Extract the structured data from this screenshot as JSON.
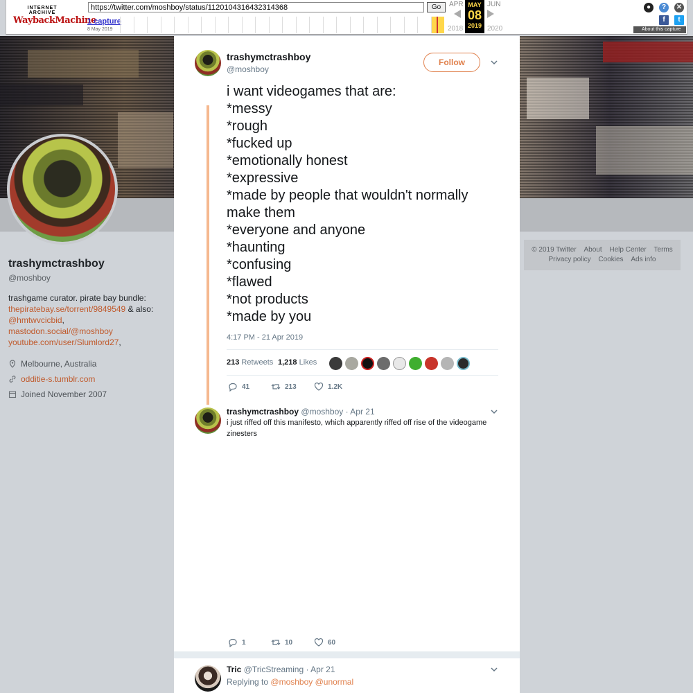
{
  "wayback": {
    "logo_top": "INTERNET ARCHIVE",
    "logo_main": "WaybackMachine",
    "url": "https://twitter.com/moshboy/status/1120104316432314368",
    "go_label": "Go",
    "captures_label": "1 capture",
    "capture_date": "8 May 2019",
    "prev_month": "APR",
    "cur_month": "MAY",
    "next_month": "JUN",
    "cur_day": "08",
    "prev_year": "2018",
    "cur_year": "2019",
    "next_year": "2020",
    "about_label": "About this capture",
    "accent": "#ffd74a"
  },
  "profile": {
    "name": "trashymctrashboy",
    "handle": "@moshboy",
    "bio_line1": "trashgame curator. pirate bay bundle:",
    "bio_link1": "thepiratebay.se/torrent/9849549",
    "bio_mid": " & also:",
    "bio_link2": "@hmtwvcicbid",
    "bio_sep": ", ",
    "bio_link3": "mastodon.social/@moshboy",
    "bio_link4": "youtube.com/user/Slumlord27",
    "bio_end": ",",
    "location": "Melbourne, Australia",
    "website": "odditie-s.tumblr.com",
    "joined": "Joined November 2007",
    "link_color": "#c05a2c"
  },
  "footer": {
    "links_row1": [
      "© 2019 Twitter",
      "About",
      "Help Center",
      "Terms"
    ],
    "links_row2": [
      "Privacy policy",
      "Cookies",
      "Ads info"
    ]
  },
  "tweet": {
    "name": "trashymctrashboy",
    "handle": "@moshboy",
    "follow_label": "Follow",
    "lines": [
      "i want videogames that are:",
      "*messy",
      "*rough",
      "*fucked up",
      "*emotionally honest",
      "*expressive",
      "*made by people that wouldn't normally",
      "make them",
      "*everyone and anyone",
      "*haunting",
      "*confusing",
      "*flawed",
      "*not products",
      "*made by you"
    ],
    "timestamp": "4:17 PM - 21 Apr 2019",
    "retweets_count": "213",
    "retweets_label": "Retweets",
    "likes_count": "1,218",
    "likes_label": "Likes",
    "reply_count": "41",
    "retweet_count": "213",
    "like_count": "1.2K",
    "accent": "#e0814d"
  },
  "reply1": {
    "name": "trashymctrashboy",
    "handle": "@moshboy",
    "date": "· Apr 21",
    "text": "i just riffed off this manifesto, which apparently riffed off rise of the videogame zinesters",
    "reply_count": "1",
    "retweet_count": "10",
    "like_count": "60"
  },
  "reply2": {
    "name": "Tric",
    "handle": "@TricStreaming",
    "date": "· Apr 21",
    "replying_to_label": "Replying to",
    "replying_to": "@moshboy @unormal"
  }
}
